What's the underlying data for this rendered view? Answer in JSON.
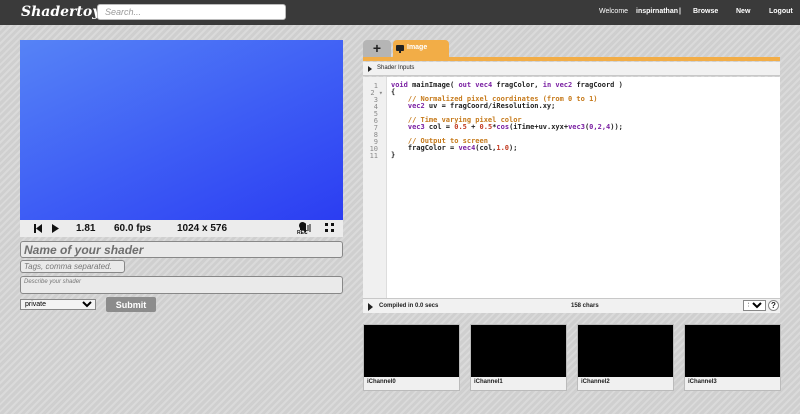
{
  "header": {
    "logo": "Shadertoy",
    "search_placeholder": "Search...",
    "welcome": "Welcome",
    "username": "inspirnathan",
    "separator": "|",
    "browse": "Browse",
    "new": "New",
    "logout": "Logout"
  },
  "player": {
    "time": "1.81",
    "fps": "60.0 fps",
    "resolution": "1024 x 576",
    "rec_label": "REC"
  },
  "form": {
    "name_placeholder": "Name of your shader",
    "tags_placeholder": "Tags, comma separated.",
    "description_placeholder": "Describe your shader",
    "privacy_selected": "private",
    "submit_label": "Submit"
  },
  "editor": {
    "add_tab": "+",
    "tab_image": "Image",
    "shader_inputs_label": "Shader Inputs",
    "line_numbers": [
      "1",
      "2 ▾",
      "3",
      "4",
      "5",
      "6",
      "7",
      "8",
      "9",
      "10",
      "11"
    ],
    "compiled_status": "Compiled in 0.0 secs",
    "char_count": "158 chars",
    "mode_selected": "S",
    "help": "?"
  },
  "channels": [
    "iChannel0",
    "iChannel1",
    "iChannel2",
    "iChannel3"
  ]
}
